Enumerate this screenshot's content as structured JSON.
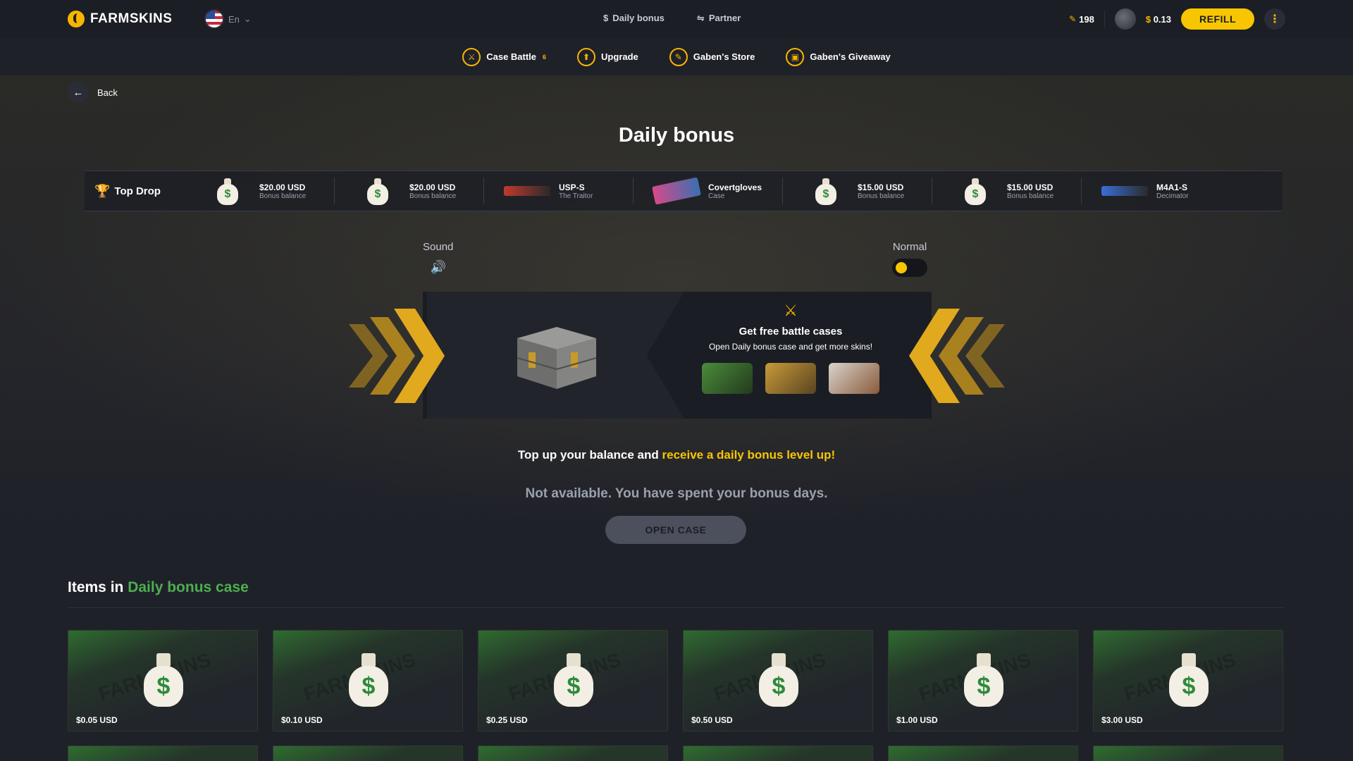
{
  "brand": {
    "name": "FARMSKINS"
  },
  "header": {
    "lang": "En",
    "nav": [
      {
        "icon": "dollar-icon",
        "label": "Daily bonus"
      },
      {
        "icon": "handshake-icon",
        "label": "Partner"
      }
    ],
    "coins": "198",
    "balance_currency": "$",
    "balance": "0.13",
    "refill_label": "REFILL"
  },
  "subnav": [
    {
      "icon": "swords-icon",
      "label": "Case Battle",
      "badge": "6"
    },
    {
      "icon": "arrow-up-icon",
      "label": "Upgrade"
    },
    {
      "icon": "feather-icon",
      "label": "Gaben's Store"
    },
    {
      "icon": "gift-icon",
      "label": "Gaben's Giveaway"
    }
  ],
  "back_label": "Back",
  "page_title": "Daily bonus",
  "top_drop": {
    "label": "Top Drop",
    "items": [
      {
        "type": "bag",
        "name": "$20.00 USD",
        "sub": "Bonus balance"
      },
      {
        "type": "bag",
        "name": "$20.00 USD",
        "sub": "Bonus balance"
      },
      {
        "type": "gun",
        "color": "#c23a2c",
        "name": "USP-S",
        "sub": "The Traitor"
      },
      {
        "type": "gloves",
        "color": "#d64a8a",
        "name": "Covertgloves",
        "sub": "Case"
      },
      {
        "type": "bag",
        "name": "$15.00 USD",
        "sub": "Bonus balance"
      },
      {
        "type": "bag",
        "name": "$15.00 USD",
        "sub": "Bonus balance"
      },
      {
        "type": "gun",
        "color": "#3a6fd8",
        "name": "M4A1-S",
        "sub": "Decimator"
      }
    ]
  },
  "sound_label": "Sound",
  "mode_label": "Normal",
  "bonus_info": {
    "title": "Get free battle cases",
    "subtitle": "Open Daily bonus case and get more skins!"
  },
  "topup": {
    "text": "Top up your balance and ",
    "highlight": "receive a daily bonus level up!"
  },
  "not_available": "Not available. You have spent your bonus days.",
  "open_case_label": "OPEN CASE",
  "items_section": {
    "title": "Items in ",
    "highlight": "Daily bonus case",
    "watermark": "FARMSKINS",
    "items": [
      {
        "price": "$0.05 USD"
      },
      {
        "price": "$0.10 USD"
      },
      {
        "price": "$0.25 USD"
      },
      {
        "price": "$0.50 USD"
      },
      {
        "price": "$1.00 USD"
      },
      {
        "price": "$3.00 USD"
      }
    ]
  },
  "colors": {
    "accent": "#f7c600",
    "green": "#4caf50",
    "bg": "#1f2129"
  }
}
